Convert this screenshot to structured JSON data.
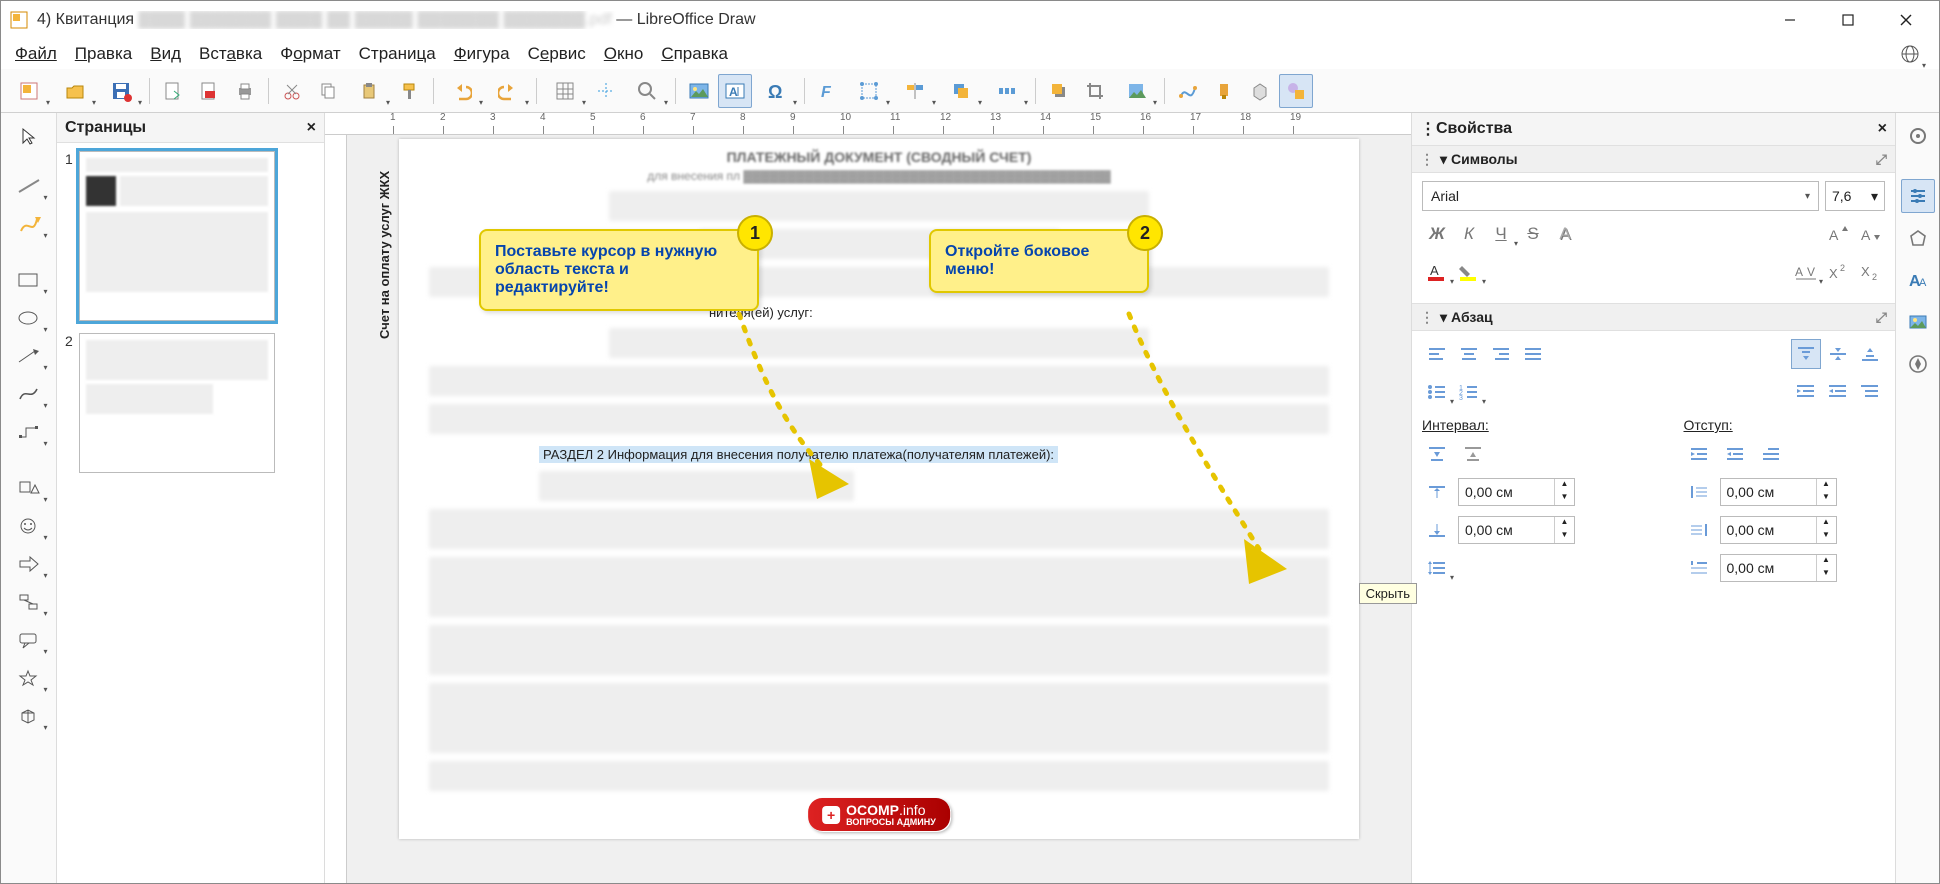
{
  "titlebar": {
    "doc_prefix": "4) Квитанция",
    "app": "LibreOffice Draw"
  },
  "menu": {
    "file": "Файл",
    "edit": "Правка",
    "view": "Вид",
    "insert": "Вставка",
    "format": "Формат",
    "page": "Страница",
    "shape": "Фигура",
    "tools": "Сервис",
    "window": "Окно",
    "help": "Справка"
  },
  "pages_panel": {
    "title": "Страницы",
    "num1": "1",
    "num2": "2"
  },
  "canvas": {
    "doc_heading": "ПЛАТЕЖНЫЙ ДОКУМЕНТ (СВОДНЫЙ СЧЕТ)",
    "doc_sub": "для внесения пл",
    "side_label": "Счет на оплату услуг ЖКХ",
    "provider_label": "нителя(ей) услуг:",
    "selected": "РАЗДЕЛ  2 Информация для внесения получателю платежа(получателям платежей):"
  },
  "callouts": {
    "c1": {
      "num": "1",
      "text": "Поставьте курсор в нужную область текста и редактируйте!"
    },
    "c2": {
      "num": "2",
      "text": "Откройте боковое меню!"
    }
  },
  "sidebar": {
    "title": "Свойства",
    "sec_chars": "Символы",
    "sec_para": "Абзац",
    "font_name": "Arial",
    "font_size": "7,6",
    "bold": "Ж",
    "italic": "К",
    "underline": "Ч",
    "strike": "S",
    "shadow": "A",
    "interval_label": "Интервал:",
    "indent_label": "Отступ:",
    "val_zero": "0,00 см",
    "tooltip_hide": "Скрыть"
  },
  "ruler": {
    "t1": "1",
    "t2": "2",
    "t3": "3",
    "t4": "4",
    "t5": "5",
    "t6": "6",
    "t7": "7",
    "t8": "8",
    "t9": "9",
    "t10": "10",
    "t11": "11",
    "t12": "12",
    "t13": "13",
    "t14": "14",
    "t15": "15",
    "t16": "16",
    "t17": "17",
    "t18": "18",
    "t19": "19"
  },
  "watermark": {
    "brand": "OCOMP",
    "tld": ".info",
    "sub": "ВОПРОСЫ АДМИНУ"
  }
}
